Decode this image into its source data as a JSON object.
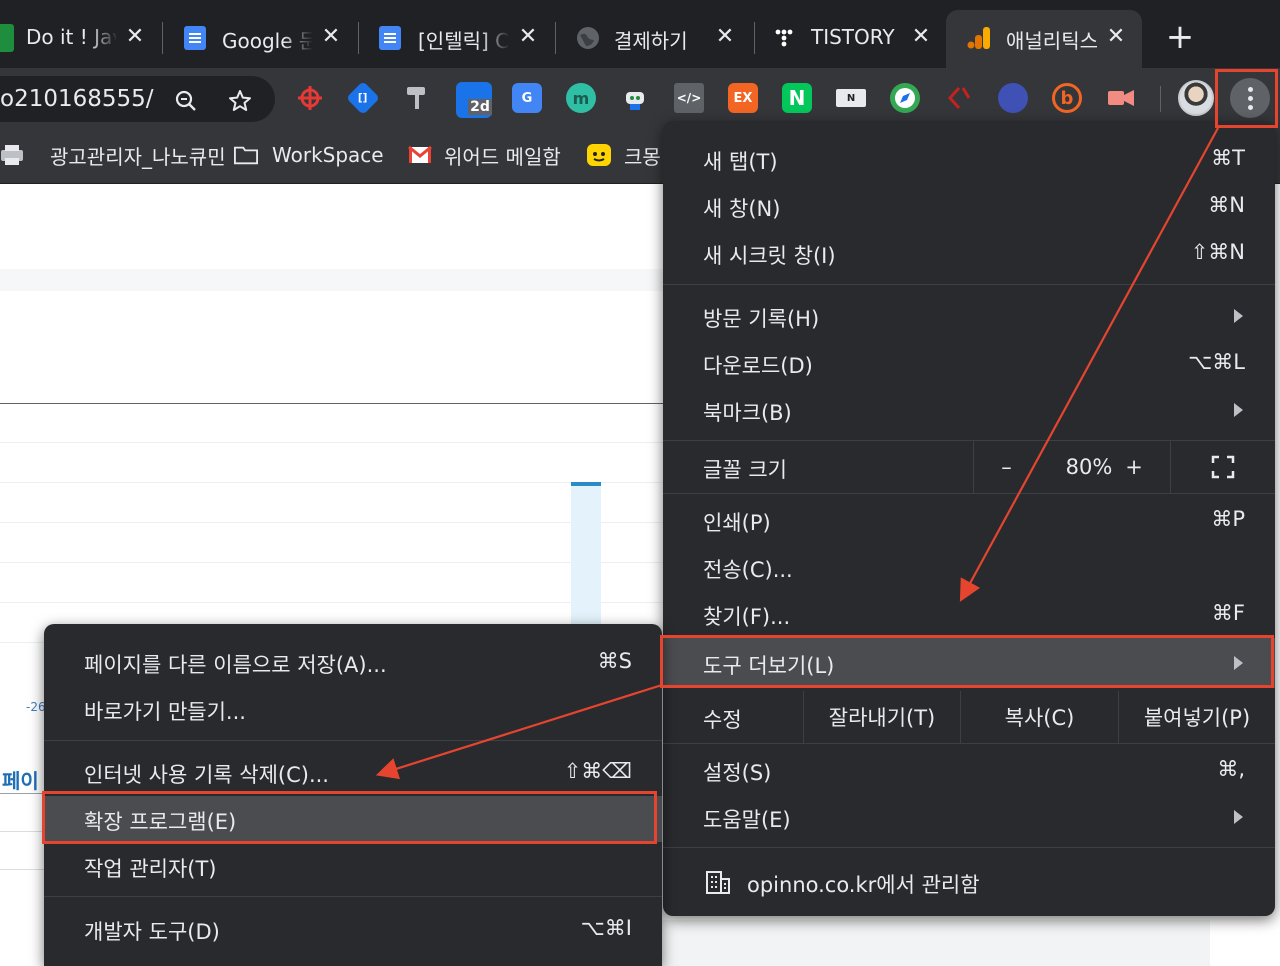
{
  "tabs": [
    {
      "title": "Do it ! Jav",
      "close": "✕"
    },
    {
      "title": "Google 문",
      "close": "✕"
    },
    {
      "title": "[인텔릭] C",
      "close": "✕"
    },
    {
      "title": "결제하기",
      "close": "✕"
    },
    {
      "title": "TISTORY",
      "close": "✕"
    },
    {
      "title": "애널리틱스",
      "close": "✕"
    }
  ],
  "new_tab": "+",
  "omnibox": {
    "text": "o210168555/"
  },
  "extensions": [
    {
      "icon": "crosshair-icon",
      "text": ""
    },
    {
      "icon": "bracket-icon",
      "text": "[]"
    },
    {
      "icon": "paint-roller-icon",
      "text": ""
    },
    {
      "icon": "calendar-2d-icon",
      "text": "2d"
    },
    {
      "icon": "google-translate-icon",
      "text": "G"
    },
    {
      "icon": "m-circle-icon",
      "text": "m"
    },
    {
      "icon": "robot-icon",
      "text": ""
    },
    {
      "icon": "code-icon",
      "text": "</>"
    },
    {
      "icon": "ex-icon",
      "text": "EX"
    },
    {
      "icon": "n-icon",
      "text": "N"
    },
    {
      "icon": "n-screen-icon",
      "text": "N"
    },
    {
      "icon": "compass-icon",
      "text": ""
    },
    {
      "icon": "angle-bracket-icon",
      "text": ""
    },
    {
      "icon": "ccc-icon",
      "text": ""
    },
    {
      "icon": "b-circle-icon",
      "text": "b"
    },
    {
      "icon": "video-icon",
      "text": ""
    }
  ],
  "bookmarks": [
    {
      "icon": "printer-icon",
      "label": "광고관리자_나노큐민"
    },
    {
      "icon": "folder-icon",
      "label": "WorkSpace"
    },
    {
      "icon": "gmail-icon",
      "label": "위어드 메일함"
    },
    {
      "icon": "face-icon",
      "label": "크몽"
    }
  ],
  "page": {
    "tick_label": "-26",
    "section_title": "페이"
  },
  "main_menu": {
    "items_top": [
      {
        "label": "새 탭(T)",
        "shortcut": "⌘T"
      },
      {
        "label": "새 창(N)",
        "shortcut": "⌘N"
      },
      {
        "label": "새 시크릿 창(I)",
        "shortcut": "⇧⌘N"
      }
    ],
    "items_history": [
      {
        "label": "방문 기록(H)",
        "shortcut": ""
      },
      {
        "label": "다운로드(D)",
        "shortcut": "⌥⌘L"
      },
      {
        "label": "북마크(B)",
        "shortcut": ""
      }
    ],
    "zoom": {
      "label": "글꼴 크기",
      "minus": "–",
      "value": "80%",
      "plus": "+"
    },
    "items_print": [
      {
        "label": "인쇄(P)",
        "shortcut": "⌘P"
      },
      {
        "label": "전송(C)...",
        "shortcut": ""
      },
      {
        "label": "찾기(F)...",
        "shortcut": "⌘F"
      },
      {
        "label": "도구 더보기(L)",
        "shortcut": ""
      }
    ],
    "edit": {
      "label": "수정",
      "cut": "잘라내기(T)",
      "copy": "복사(C)",
      "paste": "붙여넣기(P)"
    },
    "items_settings": [
      {
        "label": "설정(S)",
        "shortcut": "⌘,"
      },
      {
        "label": "도움말(E)",
        "shortcut": ""
      }
    ],
    "managed": "opinno.co.kr에서 관리함"
  },
  "sub_menu": {
    "items": [
      {
        "label": "페이지를 다른 이름으로 저장(A)...",
        "shortcut": "⌘S"
      },
      {
        "label": "바로가기 만들기...",
        "shortcut": ""
      },
      {
        "label": "인터넷 사용 기록 삭제(C)...",
        "shortcut": "⇧⌘⌫"
      },
      {
        "label": "확장 프로그램(E)",
        "shortcut": ""
      },
      {
        "label": "작업 관리자(T)",
        "shortcut": ""
      },
      {
        "label": "개발자 도구(D)",
        "shortcut": "⌥⌘I"
      }
    ]
  },
  "colors": {
    "annotation": "#e5452f",
    "menu_bg": "#292a2d",
    "highlight": "#4a4c50"
  }
}
